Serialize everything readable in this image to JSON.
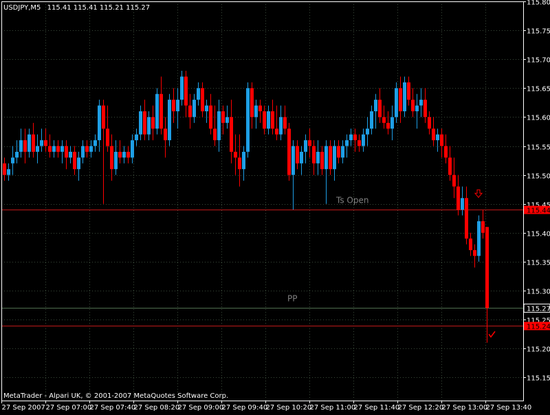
{
  "header": {
    "symbol_timeframe": "USDJPY,M5",
    "ohlc": "115.41 115.41 115.21 115.27"
  },
  "footer": {
    "copyright": "MetaTrader - Alpari UK, © 2001-2007 MetaQuotes Software Corp."
  },
  "colors": {
    "background": "#000000",
    "frame": "#FFFFFF",
    "grid": "#3A4A3A",
    "bull": "#1E9FE6",
    "bear": "#FF0000",
    "level_line": "#C01818",
    "pp_line": "#4F6F4F",
    "text": "#FFFFFF",
    "label_text": "#808080"
  },
  "chart_data": {
    "type": "candlestick",
    "ylim": [
      115.11,
      115.8
    ],
    "y_ticks": [
      "115.80",
      "115.75",
      "115.70",
      "115.65",
      "115.60",
      "115.55",
      "115.50",
      "115.45",
      "115.40",
      "115.35",
      "115.30",
      "115.25",
      "115.20",
      "115.15"
    ],
    "x_ticks": [
      "27 Sep 2007",
      "27 Sep 07:00",
      "27 Sep 07:40",
      "27 Sep 08:20",
      "27 Sep 09:00",
      "27 Sep 09:40",
      "27 Sep 10:20",
      "27 Sep 11:00",
      "27 Sep 11:40",
      "27 Sep 12:20",
      "27 Sep 13:00",
      "27 Sep 13:40"
    ],
    "grid": true,
    "levels": [
      {
        "label": "Ts Open",
        "value": 115.44,
        "tag": "115.44",
        "style": "red"
      },
      {
        "label": "PP",
        "value": 115.27,
        "tag": "",
        "style": "gray"
      },
      {
        "label": "",
        "value": 115.24,
        "tag": "115.24",
        "style": "red"
      }
    ],
    "current_price": "115.27",
    "markers": [
      {
        "type": "sell-arrow",
        "value": 115.46,
        "index": 115
      },
      {
        "type": "checkmark",
        "value": 115.22,
        "index": 117
      }
    ],
    "candles": [
      [
        115.52,
        115.53,
        115.49,
        115.5
      ],
      [
        115.5,
        115.52,
        115.49,
        115.51
      ],
      [
        115.52,
        115.55,
        115.5,
        115.53
      ],
      [
        115.53,
        115.56,
        115.52,
        115.54
      ],
      [
        115.54,
        115.58,
        115.53,
        115.56
      ],
      [
        115.56,
        115.58,
        115.52,
        115.54
      ],
      [
        115.54,
        115.58,
        115.53,
        115.57
      ],
      [
        115.57,
        115.59,
        115.53,
        115.54
      ],
      [
        115.54,
        115.57,
        115.52,
        115.55
      ],
      [
        115.55,
        115.58,
        115.54,
        115.56
      ],
      [
        115.56,
        115.58,
        115.54,
        115.55
      ],
      [
        115.55,
        115.57,
        115.53,
        115.54
      ],
      [
        115.54,
        115.56,
        115.53,
        115.55
      ],
      [
        115.55,
        115.56,
        115.53,
        115.54
      ],
      [
        115.54,
        115.56,
        115.52,
        115.55
      ],
      [
        115.55,
        115.56,
        115.51,
        115.53
      ],
      [
        115.53,
        115.55,
        115.52,
        115.54
      ],
      [
        115.54,
        115.55,
        115.5,
        115.51
      ],
      [
        115.51,
        115.54,
        115.49,
        115.53
      ],
      [
        115.53,
        115.56,
        115.52,
        115.55
      ],
      [
        115.55,
        115.56,
        115.53,
        115.54
      ],
      [
        115.54,
        115.56,
        115.53,
        115.55
      ],
      [
        115.55,
        115.57,
        115.54,
        115.56
      ],
      [
        115.56,
        115.63,
        115.54,
        115.62
      ],
      [
        115.62,
        115.63,
        115.45,
        115.58
      ],
      [
        115.58,
        115.62,
        115.54,
        115.55
      ],
      [
        115.55,
        115.57,
        115.49,
        115.51
      ],
      [
        115.51,
        115.56,
        115.5,
        115.54
      ],
      [
        115.54,
        115.56,
        115.52,
        115.53
      ],
      [
        115.53,
        115.55,
        115.52,
        115.54
      ],
      [
        115.54,
        115.55,
        115.52,
        115.53
      ],
      [
        115.53,
        115.57,
        115.52,
        115.56
      ],
      [
        115.56,
        115.58,
        115.55,
        115.57
      ],
      [
        115.57,
        115.62,
        115.56,
        115.61
      ],
      [
        115.61,
        115.63,
        115.56,
        115.57
      ],
      [
        115.57,
        115.61,
        115.56,
        115.6
      ],
      [
        115.6,
        115.62,
        115.56,
        115.58
      ],
      [
        115.58,
        115.65,
        115.57,
        115.64
      ],
      [
        115.64,
        115.67,
        115.57,
        115.58
      ],
      [
        115.58,
        115.6,
        115.53,
        115.56
      ],
      [
        115.56,
        115.64,
        115.55,
        115.63
      ],
      [
        115.63,
        115.65,
        115.59,
        115.61
      ],
      [
        115.61,
        115.65,
        115.58,
        115.63
      ],
      [
        115.63,
        115.68,
        115.62,
        115.67
      ],
      [
        115.67,
        115.68,
        115.6,
        115.62
      ],
      [
        115.62,
        115.64,
        115.58,
        115.6
      ],
      [
        115.6,
        115.64,
        115.59,
        115.63
      ],
      [
        115.63,
        115.66,
        115.62,
        115.65
      ],
      [
        115.65,
        115.66,
        115.6,
        115.61
      ],
      [
        115.61,
        115.63,
        115.59,
        115.62
      ],
      [
        115.62,
        115.64,
        115.57,
        115.58
      ],
      [
        115.58,
        115.62,
        115.55,
        115.56
      ],
      [
        115.56,
        115.63,
        115.54,
        115.61
      ],
      [
        115.61,
        115.62,
        115.57,
        115.59
      ],
      [
        115.59,
        115.62,
        115.58,
        115.6
      ],
      [
        115.6,
        115.63,
        115.52,
        115.54
      ],
      [
        115.54,
        115.57,
        115.5,
        115.53
      ],
      [
        115.53,
        115.57,
        115.48,
        115.51
      ],
      [
        115.51,
        115.55,
        115.49,
        115.54
      ],
      [
        115.54,
        115.66,
        115.53,
        115.65
      ],
      [
        115.65,
        115.66,
        115.58,
        115.6
      ],
      [
        115.6,
        115.63,
        115.58,
        115.62
      ],
      [
        115.62,
        115.63,
        115.59,
        115.61
      ],
      [
        115.61,
        115.62,
        115.57,
        115.58
      ],
      [
        115.58,
        115.62,
        115.57,
        115.61
      ],
      [
        115.61,
        115.63,
        115.57,
        115.58
      ],
      [
        115.58,
        115.62,
        115.56,
        115.57
      ],
      [
        115.57,
        115.62,
        115.56,
        115.6
      ],
      [
        115.6,
        115.62,
        115.57,
        115.58
      ],
      [
        115.58,
        115.59,
        115.49,
        115.5
      ],
      [
        115.5,
        115.56,
        115.44,
        115.55
      ],
      [
        115.55,
        115.56,
        115.51,
        115.52
      ],
      [
        115.52,
        115.55,
        115.5,
        115.54
      ],
      [
        115.54,
        115.57,
        115.52,
        115.56
      ],
      [
        115.56,
        115.58,
        115.53,
        115.55
      ],
      [
        115.55,
        115.56,
        115.5,
        115.52
      ],
      [
        115.52,
        115.56,
        115.5,
        115.54
      ],
      [
        115.54,
        115.55,
        115.5,
        115.51
      ],
      [
        115.51,
        115.56,
        115.45,
        115.55
      ],
      [
        115.55,
        115.56,
        115.5,
        115.51
      ],
      [
        115.51,
        115.56,
        115.49,
        115.55
      ],
      [
        115.55,
        115.56,
        115.52,
        115.53
      ],
      [
        115.53,
        115.56,
        115.52,
        115.55
      ],
      [
        115.55,
        115.57,
        115.53,
        115.56
      ],
      [
        115.56,
        115.58,
        115.55,
        115.57
      ],
      [
        115.57,
        115.58,
        115.54,
        115.56
      ],
      [
        115.56,
        115.57,
        115.54,
        115.55
      ],
      [
        115.55,
        115.58,
        115.54,
        115.57
      ],
      [
        115.57,
        115.6,
        115.55,
        115.58
      ],
      [
        115.58,
        115.62,
        115.57,
        115.61
      ],
      [
        115.61,
        115.64,
        115.58,
        115.63
      ],
      [
        115.63,
        115.65,
        115.59,
        115.6
      ],
      [
        115.6,
        115.62,
        115.58,
        115.59
      ],
      [
        115.59,
        115.61,
        115.57,
        115.58
      ],
      [
        115.58,
        115.62,
        115.56,
        115.6
      ],
      [
        115.6,
        115.66,
        115.59,
        115.65
      ],
      [
        115.65,
        115.67,
        115.59,
        115.61
      ],
      [
        115.61,
        115.67,
        115.6,
        115.66
      ],
      [
        115.66,
        115.67,
        115.62,
        115.63
      ],
      [
        115.63,
        115.65,
        115.6,
        115.61
      ],
      [
        115.61,
        115.64,
        115.58,
        115.62
      ],
      [
        115.62,
        115.65,
        115.6,
        115.63
      ],
      [
        115.63,
        115.65,
        115.59,
        115.6
      ],
      [
        115.6,
        115.61,
        115.57,
        115.58
      ],
      [
        115.58,
        115.6,
        115.55,
        115.56
      ],
      [
        115.56,
        115.58,
        115.54,
        115.57
      ],
      [
        115.57,
        115.58,
        115.53,
        115.55
      ],
      [
        115.55,
        115.57,
        115.52,
        115.53
      ],
      [
        115.53,
        115.55,
        115.49,
        115.5
      ],
      [
        115.5,
        115.53,
        115.46,
        115.48
      ],
      [
        115.48,
        115.5,
        115.43,
        115.44
      ],
      [
        115.44,
        115.48,
        115.43,
        115.46
      ],
      [
        115.46,
        115.48,
        115.38,
        115.39
      ],
      [
        115.39,
        115.4,
        115.36,
        115.37
      ],
      [
        115.37,
        115.38,
        115.34,
        115.36
      ],
      [
        115.36,
        115.43,
        115.35,
        115.42
      ],
      [
        115.42,
        115.44,
        115.39,
        115.4
      ],
      [
        115.41,
        115.41,
        115.21,
        115.27
      ]
    ]
  }
}
